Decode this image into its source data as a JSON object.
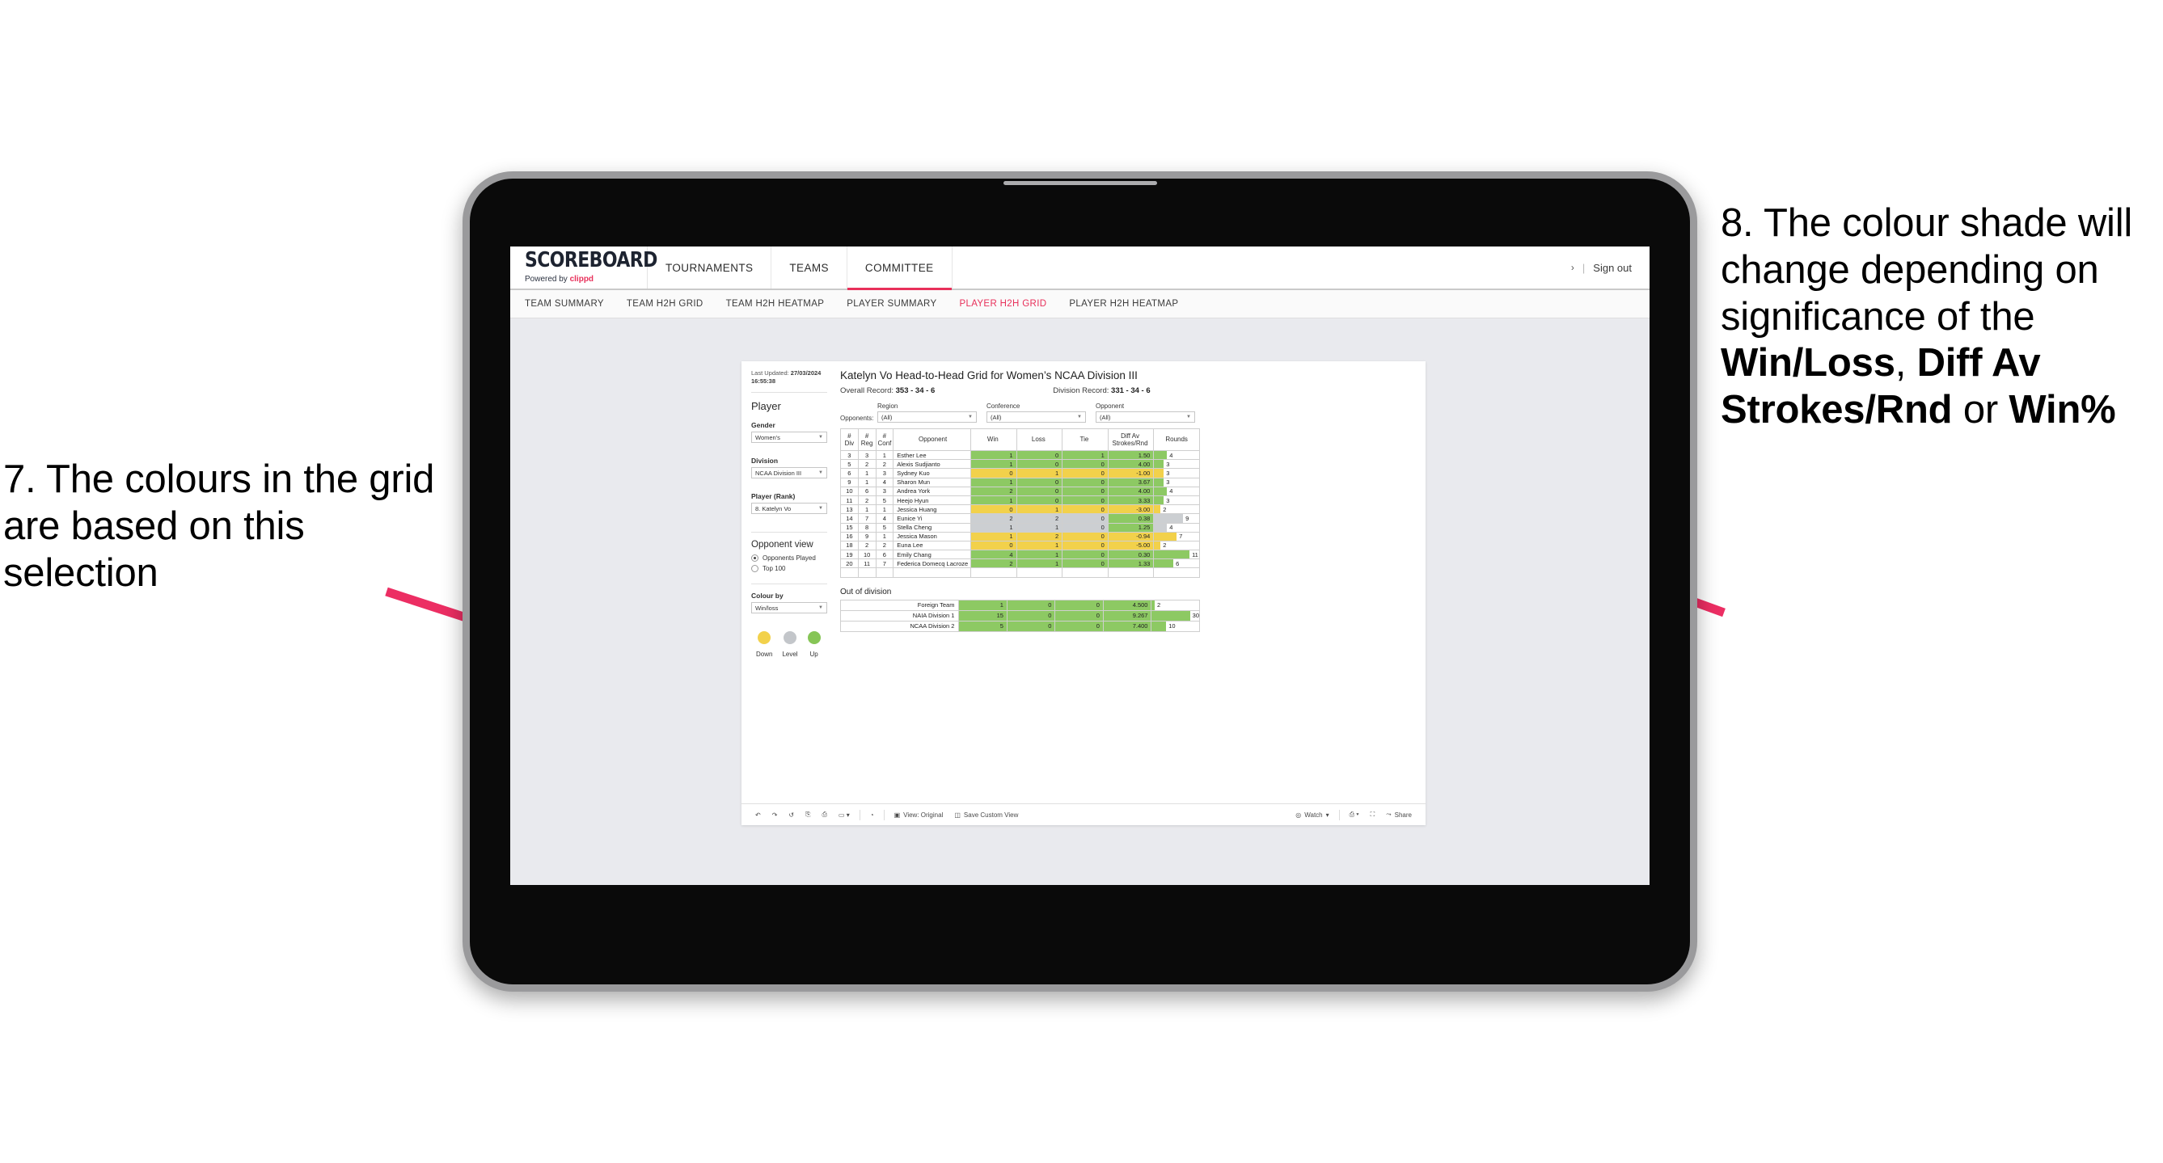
{
  "slide": {
    "annotation_left": {
      "id": "annot-7",
      "text": "7. The colours in the grid are based on this selection"
    },
    "annotation_right": {
      "id": "annot-8",
      "line1": "8. The colour shade will change depending on significance of the ",
      "bold1": "Win/Loss",
      "mid1": ", ",
      "bold2": "Diff Av Strokes/Rnd",
      "mid2": " or ",
      "bold3": "Win%"
    },
    "arrow_color": "#ec2e63"
  },
  "app": {
    "logo": {
      "main": "SCOREBOARD",
      "powered": "Powered by",
      "brand": "clippd"
    },
    "topnav": [
      {
        "label": "TOURNAMENTS",
        "active": false
      },
      {
        "label": "TEAMS",
        "active": false
      },
      {
        "label": "COMMITTEE",
        "active": true
      }
    ],
    "signout": {
      "chevron": "›",
      "separator": "|",
      "label": "Sign out"
    },
    "subnav": [
      {
        "label": "TEAM SUMMARY",
        "active": false
      },
      {
        "label": "TEAM H2H GRID",
        "active": false
      },
      {
        "label": "TEAM H2H HEATMAP",
        "active": false
      },
      {
        "label": "PLAYER SUMMARY",
        "active": false
      },
      {
        "label": "PLAYER H2H GRID",
        "active": true
      },
      {
        "label": "PLAYER H2H HEATMAP",
        "active": false
      }
    ],
    "accent": "#e8305a"
  },
  "sidebar": {
    "last_updated_label": "Last Updated:",
    "last_updated_date": "27/03/2024",
    "last_updated_time": "16:55:38",
    "player_heading": "Player",
    "gender_label": "Gender",
    "gender_value": "Women's",
    "division_label": "Division",
    "division_value": "NCAA Division III",
    "player_rank_label": "Player (Rank)",
    "player_rank_value": "8. Katelyn Vo",
    "opponent_view_heading": "Opponent view",
    "opponent_view_options": [
      {
        "label": "Opponents Played",
        "selected": true
      },
      {
        "label": "Top 100",
        "selected": false
      }
    ],
    "colour_by_label": "Colour by",
    "colour_by_value": "Win/loss",
    "legend": [
      {
        "label": "Down",
        "color": "#f2d14b"
      },
      {
        "label": "Level",
        "color": "#c3c6ca"
      },
      {
        "label": "Up",
        "color": "#86c556"
      }
    ]
  },
  "main": {
    "title": "Katelyn Vo Head-to-Head Grid for Women’s NCAA Division III",
    "overall_record_label": "Overall Record:",
    "overall_record_value": "353 -  34 - 6",
    "division_record_label": "Division Record:",
    "division_record_value": "331 -  34 - 6",
    "opponents_label": "Opponents:",
    "filters": [
      {
        "caption": "Region",
        "value": "(All)"
      },
      {
        "caption": "Conference",
        "value": "(All)"
      },
      {
        "caption": "Opponent",
        "value": "(All)"
      }
    ],
    "columns": [
      {
        "l1": "#",
        "l2": "Div"
      },
      {
        "l1": "#",
        "l2": "Reg"
      },
      {
        "l1": "#",
        "l2": "Conf"
      },
      {
        "l1": "Opponent",
        "l2": ""
      },
      {
        "l1": "Win",
        "l2": ""
      },
      {
        "l1": "Loss",
        "l2": ""
      },
      {
        "l1": "Tie",
        "l2": ""
      },
      {
        "l1": "Diff Av",
        "l2": "Strokes/Rnd"
      },
      {
        "l1": "Rounds",
        "l2": ""
      }
    ],
    "rows": [
      {
        "div": "3",
        "reg": "3",
        "conf": "1",
        "opponent": "Esther Lee",
        "win": "1",
        "loss": "0",
        "tie": "1",
        "diff": "1.50",
        "rounds": "4",
        "color": "#8dc963"
      },
      {
        "div": "5",
        "reg": "2",
        "conf": "2",
        "opponent": "Alexis Sudjianto",
        "win": "1",
        "loss": "0",
        "tie": "0",
        "diff": "4.00",
        "rounds": "3",
        "color": "#8dc963"
      },
      {
        "div": "6",
        "reg": "1",
        "conf": "3",
        "opponent": "Sydney Kuo",
        "win": "0",
        "loss": "1",
        "tie": "0",
        "diff": "-1.00",
        "rounds": "3",
        "color": "#f2d14b"
      },
      {
        "div": "9",
        "reg": "1",
        "conf": "4",
        "opponent": "Sharon Mun",
        "win": "1",
        "loss": "0",
        "tie": "0",
        "diff": "3.67",
        "rounds": "3",
        "color": "#8dc963"
      },
      {
        "div": "10",
        "reg": "6",
        "conf": "3",
        "opponent": "Andrea York",
        "win": "2",
        "loss": "0",
        "tie": "0",
        "diff": "4.00",
        "rounds": "4",
        "color": "#8dc963"
      },
      {
        "div": "11",
        "reg": "2",
        "conf": "5",
        "opponent": "Heejo Hyun",
        "win": "1",
        "loss": "0",
        "tie": "0",
        "diff": "3.33",
        "rounds": "3",
        "color": "#8dc963"
      },
      {
        "div": "13",
        "reg": "1",
        "conf": "1",
        "opponent": "Jessica Huang",
        "win": "0",
        "loss": "1",
        "tie": "0",
        "diff": "-3.00",
        "rounds": "2",
        "color": "#f2d14b"
      },
      {
        "div": "14",
        "reg": "7",
        "conf": "4",
        "opponent": "Eunice Yi",
        "win": "2",
        "loss": "2",
        "tie": "0",
        "diff": "0.38",
        "rounds": "9",
        "color": "#cccfd2",
        "diff_color": "#8dc963"
      },
      {
        "div": "15",
        "reg": "8",
        "conf": "5",
        "opponent": "Stella Cheng",
        "win": "1",
        "loss": "1",
        "tie": "0",
        "diff": "1.25",
        "rounds": "4",
        "color": "#cccfd2",
        "diff_color": "#8dc963"
      },
      {
        "div": "16",
        "reg": "9",
        "conf": "1",
        "opponent": "Jessica Mason",
        "win": "1",
        "loss": "2",
        "tie": "0",
        "diff": "-0.94",
        "rounds": "7",
        "color": "#f2d14b"
      },
      {
        "div": "18",
        "reg": "2",
        "conf": "2",
        "opponent": "Euna Lee",
        "win": "0",
        "loss": "1",
        "tie": "0",
        "diff": "-5.00",
        "rounds": "2",
        "color": "#f2d14b"
      },
      {
        "div": "19",
        "reg": "10",
        "conf": "6",
        "opponent": "Emily Chang",
        "win": "4",
        "loss": "1",
        "tie": "0",
        "diff": "0.30",
        "rounds": "11",
        "color": "#8dc963"
      },
      {
        "div": "20",
        "reg": "11",
        "conf": "7",
        "opponent": "Federica Domecq Lacroze",
        "win": "2",
        "loss": "1",
        "tie": "0",
        "diff": "1.33",
        "rounds": "6",
        "color": "#8dc963"
      }
    ],
    "rounds_max": 14,
    "out_of_division_heading": "Out of division",
    "out_of_division_rows": [
      {
        "name": "Foreign Team",
        "win": "1",
        "loss": "0",
        "tie": "0",
        "diff": "4.500",
        "rounds": "2",
        "color": "#8dc963"
      },
      {
        "name": "NAIA Division 1",
        "win": "15",
        "loss": "0",
        "tie": "0",
        "diff": "9.267",
        "rounds": "30",
        "color": "#8dc963"
      },
      {
        "name": "NCAA Division 2",
        "win": "5",
        "loss": "0",
        "tie": "0",
        "diff": "7.400",
        "rounds": "10",
        "color": "#8dc963"
      }
    ],
    "ood_rounds_max": 33
  },
  "toolbar": {
    "items": [
      {
        "name": "undo-icon",
        "glyph": "↶",
        "label": ""
      },
      {
        "name": "redo-icon",
        "glyph": "↷",
        "label": ""
      },
      {
        "name": "revert-icon",
        "glyph": "↺",
        "label": ""
      },
      {
        "name": "refresh-icon",
        "glyph": "⧉",
        "label": ""
      },
      {
        "name": "pause-icon",
        "glyph": "▭",
        "label": ""
      }
    ],
    "view_label": "View: Original",
    "save_custom_view_label": "Save Custom View",
    "watch_label": "Watch",
    "share_label": "Share"
  }
}
